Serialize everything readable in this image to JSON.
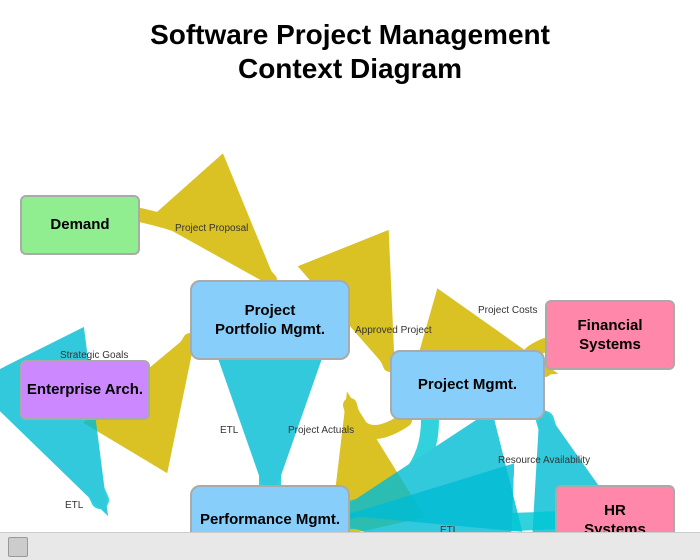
{
  "title": {
    "line1": "Software Project Management",
    "line2": "Context Diagram"
  },
  "boxes": {
    "demand": "Demand",
    "ppm": "Project\nPortfolio Mgmt.",
    "enterprise": "Enterprise Arch.",
    "projmgmt": "Project Mgmt.",
    "financial": "Financial\nSystems",
    "performance": "Performance Mgmt.",
    "hr": "HR\nSystems"
  },
  "labels": {
    "project_proposal": "Project\nProposal",
    "strategic_goals": "Strategic\nGoals",
    "etl_left": "ETL",
    "approved_project": "Approved\nProject",
    "project_costs": "Project\nCosts",
    "project_actuals": "Project\nActuals",
    "etl_bottom_left": "ETL",
    "etl_bottom_right": "ETL",
    "resource_availability": "Resource\nAvailability"
  }
}
